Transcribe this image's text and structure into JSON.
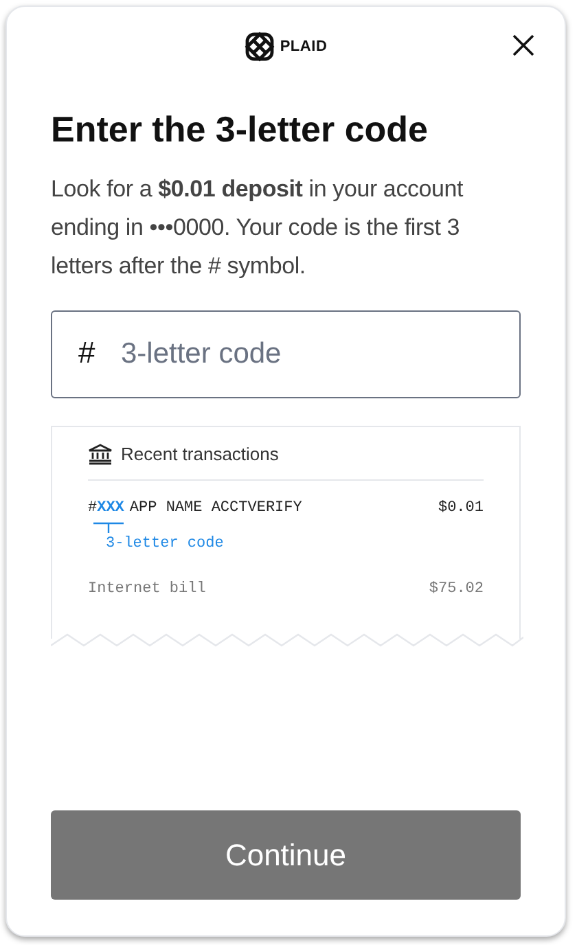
{
  "header": {
    "brand": "PLAID"
  },
  "title": "Enter the 3-letter code",
  "description": "Look for a **$0.01 deposit** in your account ending in •••0000. Your code is the first 3 letters after the # symbol.",
  "code_field": {
    "prefix": "#",
    "placeholder": "3-letter code"
  },
  "receipt": {
    "title": "Recent transactions",
    "rows": [
      {
        "kind": "verify",
        "prefix": "#",
        "code": "XXX",
        "name": "APP NAME ACCTVERIFY",
        "amount": "$0.01",
        "annotation": "3-letter code"
      },
      {
        "kind": "plain",
        "name": "Internet bill",
        "amount": "$75.02"
      }
    ]
  },
  "continue_button": {
    "label": "Continue",
    "disabled": true
  }
}
